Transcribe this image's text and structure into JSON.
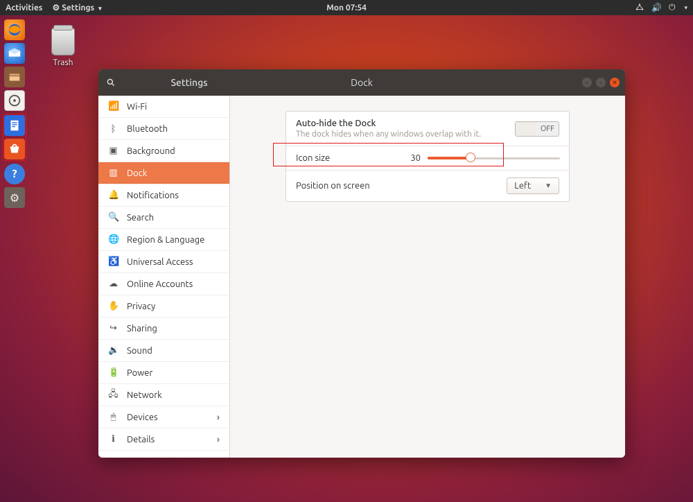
{
  "top_panel": {
    "activities": "Activities",
    "app_menu": "Settings",
    "time": "Mon 07:54"
  },
  "desktop": {
    "trash": "Trash"
  },
  "dock_items": [
    "firefox",
    "thunderbird",
    "files",
    "rhythmbox",
    "libreoffice-writer",
    "ubuntu-software",
    "help",
    "settings"
  ],
  "window": {
    "search_tooltip": "Search",
    "title_left": "Settings",
    "title_center": "Dock"
  },
  "sidebar": {
    "items": [
      {
        "icon": "wifi",
        "label": "Wi-Fi"
      },
      {
        "icon": "bluetooth",
        "label": "Bluetooth"
      },
      {
        "icon": "background",
        "label": "Background"
      },
      {
        "icon": "dock",
        "label": "Dock",
        "active": true
      },
      {
        "icon": "bell",
        "label": "Notifications"
      },
      {
        "icon": "search",
        "label": "Search"
      },
      {
        "icon": "globe",
        "label": "Region & Language"
      },
      {
        "icon": "access",
        "label": "Universal Access"
      },
      {
        "icon": "cloud",
        "label": "Online Accounts"
      },
      {
        "icon": "hand",
        "label": "Privacy"
      },
      {
        "icon": "share",
        "label": "Sharing"
      },
      {
        "icon": "sound",
        "label": "Sound"
      },
      {
        "icon": "power",
        "label": "Power"
      },
      {
        "icon": "network",
        "label": "Network"
      },
      {
        "icon": "devices",
        "label": "Devices",
        "sub": true
      },
      {
        "icon": "details",
        "label": "Details",
        "sub": true
      }
    ]
  },
  "dock_settings": {
    "autohide_title": "Auto-hide the Dock",
    "autohide_desc": "The dock hides when any windows overlap with it.",
    "autohide_state": "OFF",
    "icon_size_label": "Icon size",
    "icon_size_value": "30",
    "position_label": "Position on screen",
    "position_value": "Left"
  }
}
